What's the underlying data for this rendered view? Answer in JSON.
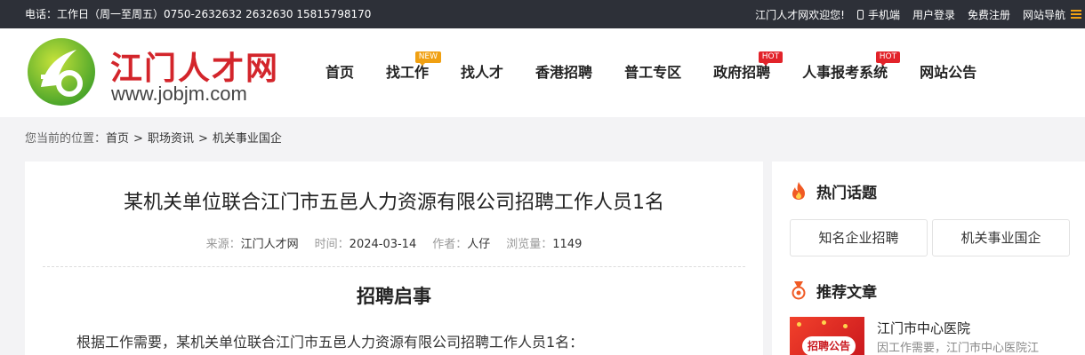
{
  "topbar": {
    "contact": "电话：工作日（周一至周五）0750-2632632 2632630 15815798170",
    "welcome": "江门人才网欢迎您!",
    "mobile": "手机端",
    "login": "用户登录",
    "register": "免费注册",
    "site_nav": "网站导航"
  },
  "logo": {
    "cn": "江门人才网",
    "en": "www.jobjm.com"
  },
  "nav": [
    {
      "label": "首页",
      "tag": ""
    },
    {
      "label": "找工作",
      "tag": "NEW"
    },
    {
      "label": "找人才",
      "tag": ""
    },
    {
      "label": "香港招聘",
      "tag": ""
    },
    {
      "label": "普工专区",
      "tag": ""
    },
    {
      "label": "政府招聘",
      "tag": "HOT"
    },
    {
      "label": "人事报考系统",
      "tag": "HOT"
    },
    {
      "label": "网站公告",
      "tag": ""
    }
  ],
  "breadcrumb": {
    "prefix": "您当前的位置：",
    "items": [
      "首页",
      "职场资讯",
      "机关事业国企"
    ],
    "separator": ">"
  },
  "article": {
    "title": "某机关单位联合江门市五邑人力资源有限公司招聘工作人员1名",
    "meta": {
      "source_label": "来源：",
      "source": "江门人才网",
      "time_label": "时间：",
      "time": "2024-03-14",
      "author_label": "作者：",
      "author": "人仔",
      "views_label": "浏览量：",
      "views": "1149"
    },
    "sub_heading": "招聘启事",
    "paragraph": "根据工作需要，某机关单位联合江门市五邑人力资源有限公司招聘工作人员1名："
  },
  "sidebar": {
    "hot_topics_title": "热门话题",
    "topics": [
      "知名企业招聘",
      "机关事业国企"
    ],
    "recommended_title": "推荐文章",
    "recommended": [
      {
        "thumb_text": "招聘公告",
        "title": "江门市中心医院",
        "desc": "因工作需要，江门市中心医院江"
      }
    ]
  },
  "colors": {
    "topbar_bg": "#2d3038",
    "brand_red": "#d3252b",
    "tag_new": "#f0a012",
    "tag_hot": "#e2232a",
    "logo_green": "#6cb92d",
    "hot_flame": "#f05a24"
  }
}
